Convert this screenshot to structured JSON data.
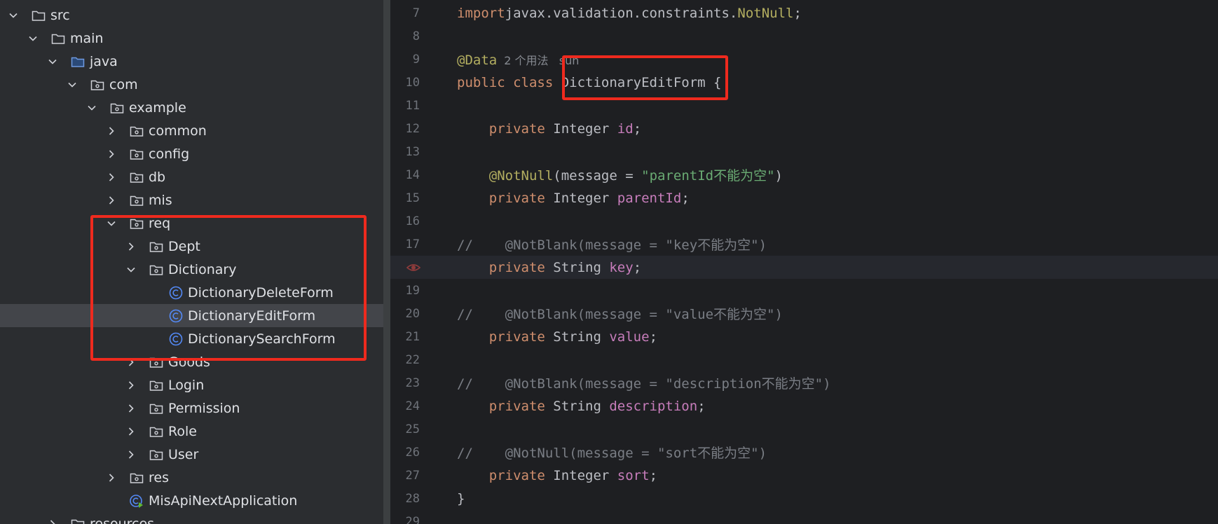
{
  "project_tree": {
    "items": [
      {
        "label": "src",
        "icon": "folder-icon",
        "chevron": "down"
      },
      {
        "label": "main",
        "icon": "folder-icon",
        "chevron": "down"
      },
      {
        "label": "java",
        "icon": "source-folder-icon",
        "chevron": "down"
      },
      {
        "label": "com",
        "icon": "package-icon",
        "chevron": "down"
      },
      {
        "label": "example",
        "icon": "package-icon",
        "chevron": "down"
      },
      {
        "label": "common",
        "icon": "package-icon",
        "chevron": "right"
      },
      {
        "label": "config",
        "icon": "package-icon",
        "chevron": "right"
      },
      {
        "label": "db",
        "icon": "package-icon",
        "chevron": "right"
      },
      {
        "label": "mis",
        "icon": "package-icon",
        "chevron": "right"
      },
      {
        "label": "req",
        "icon": "package-icon",
        "chevron": "down"
      },
      {
        "label": "Dept",
        "icon": "package-icon",
        "chevron": "right"
      },
      {
        "label": "Dictionary",
        "icon": "package-icon",
        "chevron": "down"
      },
      {
        "label": "DictionaryDeleteForm",
        "icon": "class-icon",
        "chevron": "none"
      },
      {
        "label": "DictionaryEditForm",
        "icon": "class-icon",
        "chevron": "none",
        "selected": true
      },
      {
        "label": "DictionarySearchForm",
        "icon": "class-icon",
        "chevron": "none"
      },
      {
        "label": "Goods",
        "icon": "package-icon",
        "chevron": "right"
      },
      {
        "label": "Login",
        "icon": "package-icon",
        "chevron": "right"
      },
      {
        "label": "Permission",
        "icon": "package-icon",
        "chevron": "right"
      },
      {
        "label": "Role",
        "icon": "package-icon",
        "chevron": "right"
      },
      {
        "label": "User",
        "icon": "package-icon",
        "chevron": "right"
      },
      {
        "label": "res",
        "icon": "package-icon",
        "chevron": "right"
      },
      {
        "label": "MisApiNextApplication",
        "icon": "spring-boot-class-icon",
        "chevron": "none"
      },
      {
        "label": "resources",
        "icon": "resources-folder-icon",
        "chevron": "right"
      }
    ]
  },
  "editor": {
    "lines": [
      {
        "number": "7",
        "tokens": [
          [
            "kw",
            "import"
          ],
          [
            "",
            "javax.validation.constraints."
          ],
          [
            "ann",
            "NotNull"
          ],
          [
            "",
            ";"
          ]
        ]
      },
      {
        "number": "8",
        "tokens": []
      },
      {
        "number": "9",
        "tokens": [
          [
            "ann",
            "@Data"
          ]
        ],
        "inlay": "2 个用法   sun"
      },
      {
        "number": "10",
        "tokens": [
          [
            "kw",
            "public class "
          ],
          [
            "",
            "DictionaryEditForm {"
          ]
        ]
      },
      {
        "number": "11",
        "tokens": []
      },
      {
        "number": "12",
        "tokens": [
          [
            "",
            "    "
          ],
          [
            "kw",
            "private "
          ],
          [
            "",
            "Integer "
          ],
          [
            "fld",
            "id"
          ],
          [
            "",
            ";"
          ]
        ]
      },
      {
        "number": "13",
        "tokens": []
      },
      {
        "number": "14",
        "tokens": [
          [
            "",
            "    "
          ],
          [
            "ann",
            "@NotNull"
          ],
          [
            "",
            "(message = "
          ],
          [
            "str",
            "\"parentId不能为空\""
          ],
          [
            "",
            ")"
          ]
        ]
      },
      {
        "number": "15",
        "tokens": [
          [
            "",
            "    "
          ],
          [
            "kw",
            "private "
          ],
          [
            "",
            "Integer "
          ],
          [
            "fld",
            "parentId"
          ],
          [
            "",
            ";"
          ]
        ]
      },
      {
        "number": "16",
        "tokens": []
      },
      {
        "number": "17",
        "tokens": [
          [
            "cmt",
            "//    @NotBlank(message = \"key不能为空\")"
          ]
        ]
      },
      {
        "number": "",
        "tokens": [
          [
            "",
            "    "
          ],
          [
            "kw",
            "private "
          ],
          [
            "",
            "String "
          ],
          [
            "fld",
            "key"
          ],
          [
            "",
            ";"
          ]
        ],
        "current": true,
        "gutter_icon": "breakpoint-eye-icon"
      },
      {
        "number": "19",
        "tokens": []
      },
      {
        "number": "20",
        "tokens": [
          [
            "cmt",
            "//    @NotBlank(message = \"value不能为空\")"
          ]
        ]
      },
      {
        "number": "21",
        "tokens": [
          [
            "",
            "    "
          ],
          [
            "kw",
            "private "
          ],
          [
            "",
            "String "
          ],
          [
            "fld",
            "value"
          ],
          [
            "",
            ";"
          ]
        ]
      },
      {
        "number": "22",
        "tokens": []
      },
      {
        "number": "23",
        "tokens": [
          [
            "cmt",
            "//    @NotBlank(message = \"description不能为空\")"
          ]
        ]
      },
      {
        "number": "24",
        "tokens": [
          [
            "",
            "    "
          ],
          [
            "kw",
            "private "
          ],
          [
            "",
            "String "
          ],
          [
            "fld",
            "description"
          ],
          [
            "",
            ";"
          ]
        ]
      },
      {
        "number": "25",
        "tokens": []
      },
      {
        "number": "26",
        "tokens": [
          [
            "cmt",
            "//    @NotNull(message = \"sort不能为空\")"
          ]
        ]
      },
      {
        "number": "27",
        "tokens": [
          [
            "",
            "    "
          ],
          [
            "kw",
            "private "
          ],
          [
            "",
            "Integer "
          ],
          [
            "fld",
            "sort"
          ],
          [
            "",
            ";"
          ]
        ]
      },
      {
        "number": "28",
        "tokens": [
          [
            "",
            "}"
          ]
        ]
      },
      {
        "number": "29",
        "tokens": []
      }
    ]
  },
  "colors": {
    "tree_bg": "#2b2d30",
    "editor_bg": "#1e1f22",
    "highlight_box": "#ee2a1e",
    "keyword": "#cf8e6d",
    "annotation": "#b3ae60",
    "field": "#c77dbb",
    "string": "#6aab73",
    "comment": "#7a7e85"
  }
}
